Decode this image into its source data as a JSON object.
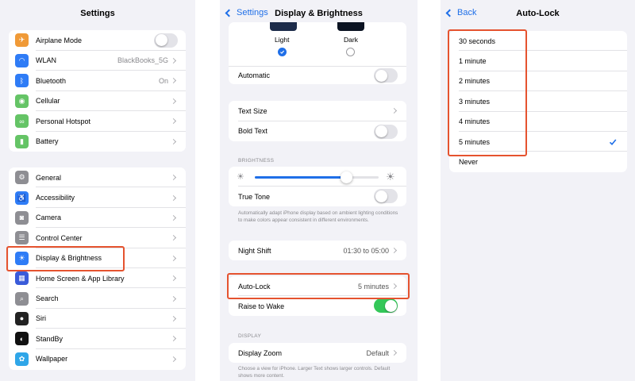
{
  "settings": {
    "title": "Settings",
    "group1": [
      {
        "label": "Airplane Mode",
        "icon": "airplane-icon",
        "color": "#f09a37",
        "kind": "toggle",
        "on": false
      },
      {
        "label": "WLAN",
        "value": "BlackBooks_5G",
        "icon": "wifi-icon",
        "color": "#2f7cf6",
        "kind": "chevron"
      },
      {
        "label": "Bluetooth",
        "value": "On",
        "icon": "bluetooth-icon",
        "color": "#2f7cf6",
        "kind": "chevron"
      },
      {
        "label": "Cellular",
        "icon": "cellular-icon",
        "color": "#65c466",
        "kind": "chevron"
      },
      {
        "label": "Personal Hotspot",
        "icon": "hotspot-icon",
        "color": "#65c466",
        "kind": "chevron"
      },
      {
        "label": "Battery",
        "icon": "battery-icon",
        "color": "#65c466",
        "kind": "chevron"
      }
    ],
    "group2": [
      {
        "label": "General",
        "icon": "gear-icon",
        "color": "#8e8e93"
      },
      {
        "label": "Accessibility",
        "icon": "accessibility-icon",
        "color": "#2f7cf6"
      },
      {
        "label": "Camera",
        "icon": "camera-icon",
        "color": "#8e8e93"
      },
      {
        "label": "Control Center",
        "icon": "control-center-icon",
        "color": "#8e8e93"
      },
      {
        "label": "Display & Brightness",
        "icon": "brightness-icon",
        "color": "#2f7cf6"
      },
      {
        "label": "Home Screen & App Library",
        "icon": "home-screen-icon",
        "color": "#3a5bd9"
      },
      {
        "label": "Search",
        "icon": "search-icon",
        "color": "#8e8e93"
      },
      {
        "label": "Siri",
        "icon": "siri-icon",
        "color": "#222222"
      },
      {
        "label": "StandBy",
        "icon": "standby-icon",
        "color": "#111111"
      },
      {
        "label": "Wallpaper",
        "icon": "wallpaper-icon",
        "color": "#2fa6e8"
      }
    ]
  },
  "display": {
    "back": "Settings",
    "title": "Display & Brightness",
    "appearance": {
      "light": "Light",
      "dark": "Dark",
      "selected": "Light"
    },
    "automatic": "Automatic",
    "text_size": "Text Size",
    "bold_text": "Bold Text",
    "brightness_header": "BRIGHTNESS",
    "brightness_level": 0.74,
    "true_tone": "True Tone",
    "true_tone_note": "Automatically adapt iPhone display based on ambient lighting conditions to make colors appear consistent in different environments.",
    "night_shift": "Night Shift",
    "night_shift_value": "01:30 to 05:00",
    "auto_lock": "Auto-Lock",
    "auto_lock_value": "5 minutes",
    "raise_to_wake": "Raise to Wake",
    "raise_to_wake_on": true,
    "display_header": "DISPLAY",
    "display_zoom": "Display Zoom",
    "display_zoom_value": "Default",
    "zoom_note": "Choose a view for iPhone. Larger Text shows larger controls. Default shows more content."
  },
  "autolock": {
    "back": "Back",
    "title": "Auto-Lock",
    "options": [
      "30 seconds",
      "1 minute",
      "2 minutes",
      "3 minutes",
      "4 minutes",
      "5 minutes",
      "Never"
    ],
    "selected": "5 minutes"
  },
  "accent": "#1f6fe8",
  "highlight_color": "#e5532f"
}
